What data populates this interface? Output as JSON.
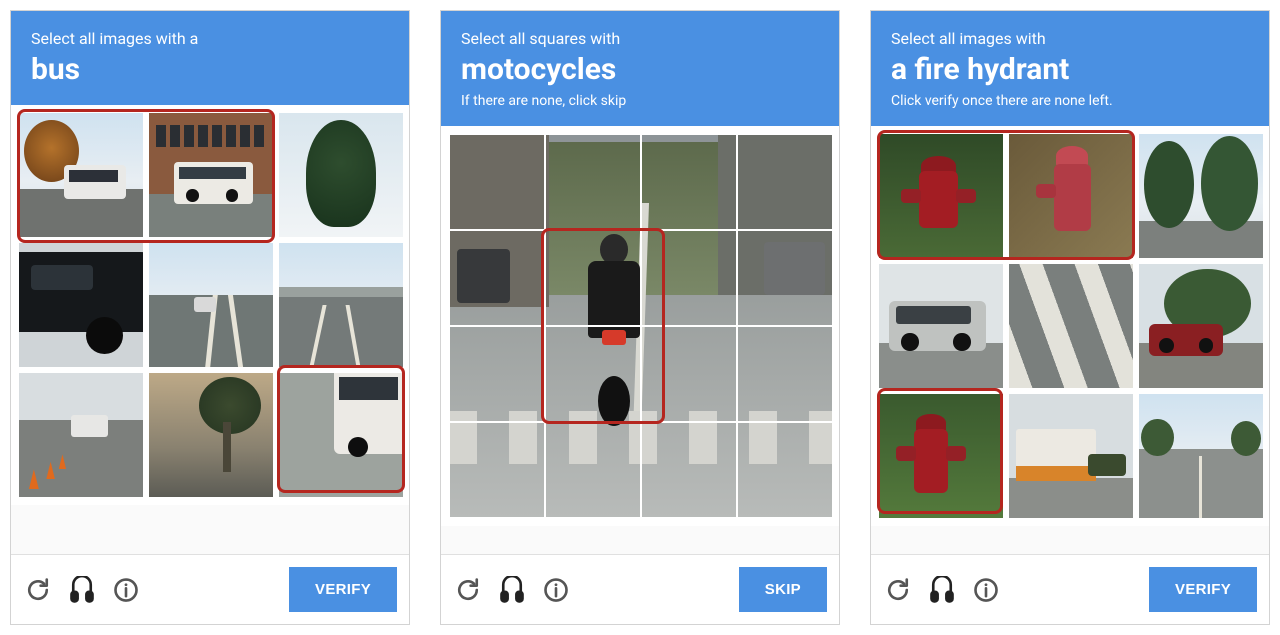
{
  "colors": {
    "accent": "#4a90e2",
    "highlight": "#b5261f"
  },
  "captchas": [
    {
      "header": {
        "line1": "Select all images with a",
        "subject": "bus",
        "line3": ""
      },
      "grid_type": "3x3",
      "tiles": [
        {
          "desc": "small white bus on street with autumn tree"
        },
        {
          "desc": "white shuttle bus in front of brick building"
        },
        {
          "desc": "pine tree against sky"
        },
        {
          "desc": "side of dark SUV close-up"
        },
        {
          "desc": "highway with car, street lights"
        },
        {
          "desc": "highway overpass intersection"
        },
        {
          "desc": "road with traffic cones and pickup truck"
        },
        {
          "desc": "palm tree and street at dusk"
        },
        {
          "desc": "rear of white bus on road"
        }
      ],
      "highlighted_tiles": [
        0,
        1,
        8
      ],
      "action_label": "VERIFY"
    },
    {
      "header": {
        "line1": "Select all squares with",
        "subject": "motocycles",
        "line3": "If there are none, click skip"
      },
      "grid_type": "4x4",
      "single_image_desc": "rider on motorcycle from behind on city street with crosswalk",
      "highlighted_cells": [
        5,
        6,
        9,
        10
      ],
      "action_label": "SKIP"
    },
    {
      "header": {
        "line1": "Select all images with",
        "subject": "a fire hydrant",
        "line3": "Click verify once there are none left."
      },
      "grid_type": "3x3",
      "tiles": [
        {
          "desc": "red fire hydrant in green foliage"
        },
        {
          "desc": "red fire hydrant on dirt slope"
        },
        {
          "desc": "tall trees lining street"
        },
        {
          "desc": "silver SUV parked on street"
        },
        {
          "desc": "crosswalk stripes"
        },
        {
          "desc": "red car parked by sidewalk trees"
        },
        {
          "desc": "red fire hydrant on grass"
        },
        {
          "desc": "U-Haul truck with car behind"
        },
        {
          "desc": "wide empty road perspective"
        }
      ],
      "highlighted_tiles": [
        0,
        1,
        6
      ],
      "action_label": "VERIFY"
    }
  ],
  "footer_icons": {
    "reload": "reload",
    "audio": "audio",
    "info": "info"
  }
}
